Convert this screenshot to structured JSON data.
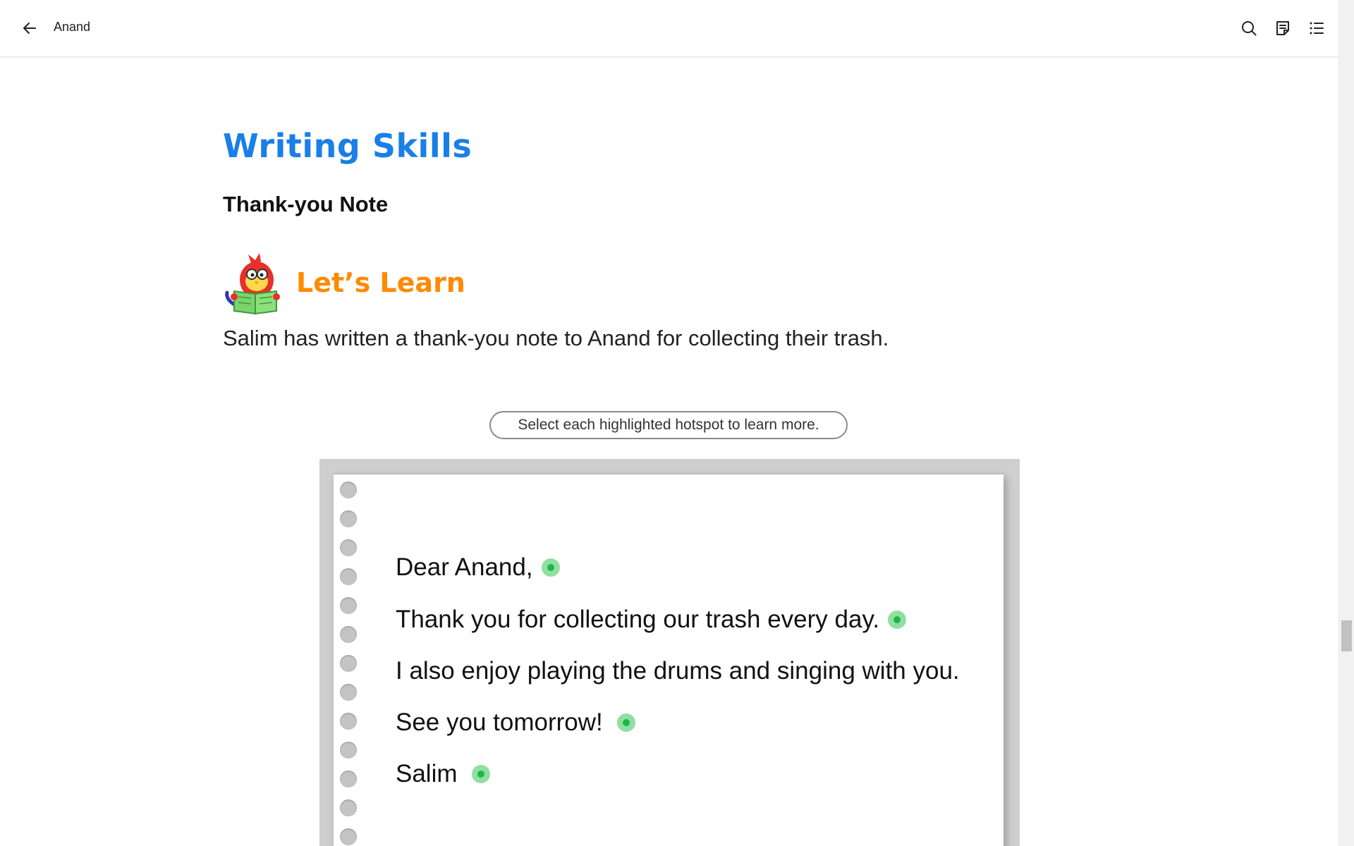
{
  "topbar": {
    "title": "Anand",
    "icons": {
      "back": "arrow-left-icon",
      "search": "search-icon",
      "notes": "notes-icon",
      "toc": "list-icon"
    }
  },
  "content": {
    "heading": "Writing Skills",
    "subheading": "Thank-you Note",
    "learn_title": "Let’s Learn",
    "intro": "Salim has written a thank-you note to Anand for collecting their trash.",
    "instruction": "Select each highlighted hotspot to learn more."
  },
  "note": {
    "lines": [
      {
        "text": "Dear Anand,",
        "hotspot": true
      },
      {
        "text": "Thank you for collecting our trash every day.",
        "hotspot": true
      },
      {
        "text": "I also enjoy playing the drums and singing with you.",
        "hotspot": false
      },
      {
        "text": "See you tomorrow!",
        "hotspot": true
      },
      {
        "text": "Salim",
        "hotspot": true
      }
    ]
  },
  "colors": {
    "heading": "#1a7fe6",
    "learn_title": "#ff8a00",
    "hotspot": "#1fb54a"
  }
}
